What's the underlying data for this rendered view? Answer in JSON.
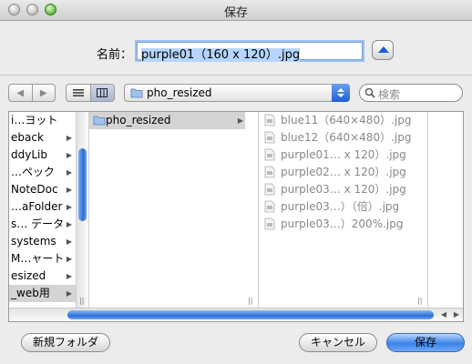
{
  "window": {
    "title": "保存"
  },
  "save_as": {
    "label": "名前：",
    "value": "purple01（160 x 120）.jpg"
  },
  "toolbar": {
    "back_label": "◀",
    "forward_label": "▶",
    "path": "pho_resized",
    "search_placeholder": "検索"
  },
  "columns": {
    "col1": [
      {
        "label": "i…ヨット",
        "has_children": false
      },
      {
        "label": "eback",
        "has_children": true
      },
      {
        "label": "ddyLib",
        "has_children": true
      },
      {
        "label": "…ペック",
        "has_children": true
      },
      {
        "label": "NoteDoc",
        "has_children": true
      },
      {
        "label": "…aFolder",
        "has_children": true
      },
      {
        "label": "s… データ",
        "has_children": true
      },
      {
        "label": "systems",
        "has_children": true
      },
      {
        "label": "M…ャート",
        "has_children": true
      },
      {
        "label": "esized",
        "has_children": true
      },
      {
        "label": "_web用",
        "has_children": true,
        "selected": true
      }
    ],
    "col2": [
      {
        "label": "pho_resized",
        "selected": true
      }
    ],
    "col3": [
      "blue11（640×480）.jpg",
      "blue12（640×480）.jpg",
      "purple01… x 120）.jpg",
      "purple02… x 120）.jpg",
      "purple03… x 120）.jpg",
      "purple03…）（倍）.jpg",
      "purple03…）200%.jpg"
    ]
  },
  "buttons": {
    "new_folder": "新規フォルダ",
    "cancel": "キャンセル",
    "save": "保存"
  },
  "colors": {
    "accent": "#3a82ea",
    "selection": "#b5d5ff"
  }
}
